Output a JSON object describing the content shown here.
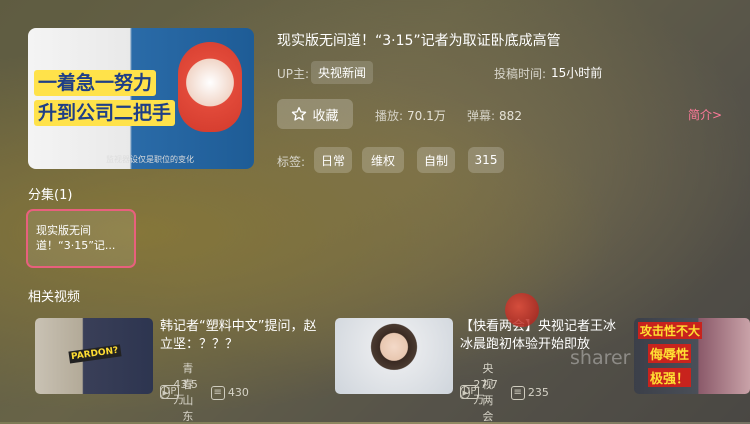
{
  "video": {
    "title": "现实版无间道！“3·15”记者为取证卧底成高管",
    "cover_text_line1": "一着急一努力",
    "cover_text_line2": "升到公司二把手",
    "cover_caption": "监视器设仅是职位的变化",
    "up_label": "UP主:",
    "up_name": "央视新闻",
    "posted_label": "投稿时间:",
    "posted_value": "15小时前",
    "favorite_label": "收藏",
    "play_label": "播放:",
    "play_value": "70.1万",
    "danmaku_label": "弹幕:",
    "danmaku_value": "882",
    "intro_label": "简介>",
    "tags_label": "标签:",
    "tags": [
      "日常",
      "维权",
      "自制",
      "315"
    ]
  },
  "episodes": {
    "header": "分集(1)",
    "items": [
      {
        "line1": "现实版无间",
        "line2": "道！“3·15”记..."
      }
    ]
  },
  "related": {
    "header": "相关视频",
    "items": [
      {
        "title": "韩记者“塑料中文”提问，赵立坚：？？？",
        "up": "青春山东",
        "plays": "43.5万",
        "danmaku": "430",
        "thumb_text": "PARDON?"
      },
      {
        "title": "【快看两会】央视记者王冰冰晨跑初体验开始即放",
        "up": "央视两会",
        "plays": "27.7万",
        "danmaku": "235"
      },
      {
        "title": "",
        "thumb_text_1": "攻击性不大",
        "thumb_text_2": "侮辱性",
        "thumb_text_3": "极强！"
      }
    ]
  },
  "watermark": "sharer"
}
